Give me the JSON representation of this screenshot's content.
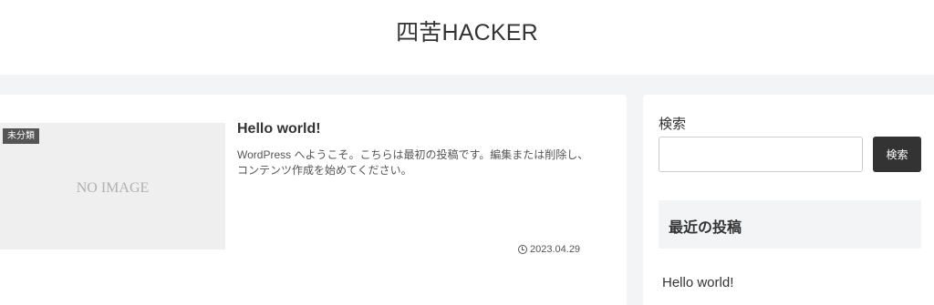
{
  "site": {
    "title": "四苦HACKER"
  },
  "post": {
    "thumbnail_text": "NO IMAGE",
    "category": "未分類",
    "title": "Hello world!",
    "excerpt": "WordPress へようこそ。こちらは最初の投稿です。編集または削除し、コンテンツ作成を始めてください。",
    "date": "2023.04.29"
  },
  "sidebar": {
    "search_label": "検索",
    "search_placeholder": "",
    "search_button": "検索",
    "recent_heading": "最近の投稿",
    "recent_posts": [
      "Hello world!"
    ]
  }
}
